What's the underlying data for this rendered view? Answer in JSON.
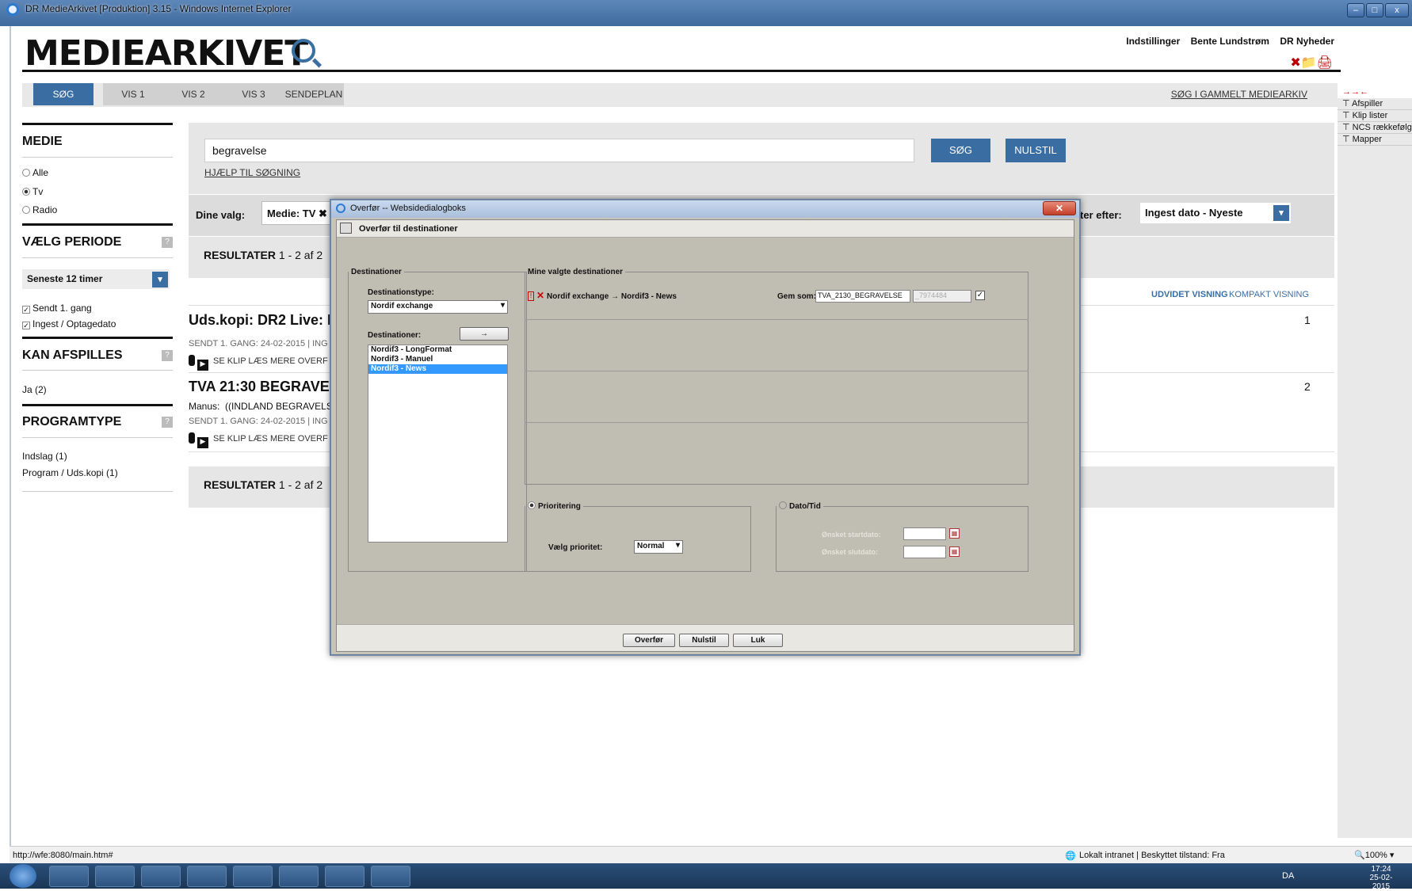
{
  "window": {
    "title": "DR MedieArkivet [Produktion] 3.15 - Windows Internet Explorer",
    "minimize": "–",
    "maximize": "□",
    "close": "x"
  },
  "header": {
    "logo": "MEDIEARKIVET",
    "settings": "Indstillinger",
    "user": "Bente Lundstrøm",
    "department": "DR Nyheder",
    "toolicons": "✖📁🖨"
  },
  "nav": {
    "tabs": [
      "SØG",
      "VIS 1",
      "VIS 2",
      "VIS 3",
      "SENDEPLAN"
    ],
    "old_archive_link": "SØG I GAMMELT MEDIEARKIV"
  },
  "right_sidebar": {
    "arrows": "→→←",
    "items": [
      "Afspiller",
      "Klip lister",
      "NCS rækkefølge",
      "Mapper"
    ]
  },
  "facets": {
    "medie": {
      "title": "MEDIE",
      "options": [
        "Alle",
        "Tv",
        "Radio"
      ],
      "selected": "Tv"
    },
    "periode": {
      "title": "VÆLG PERIODE",
      "help": "?",
      "select": "Seneste 12 timer",
      "checks": [
        "Sendt 1. gang",
        "Ingest / Optagedato"
      ]
    },
    "afspilles": {
      "title": "KAN AFSPILLES",
      "help": "?",
      "items": [
        "Ja (2)"
      ]
    },
    "programtype": {
      "title": "PROGRAMTYPE",
      "help": "?",
      "items": [
        "Indslag (1)",
        "Program / Uds.kopi (1)"
      ]
    }
  },
  "search": {
    "query": "begravelse",
    "search_button": "SØG",
    "reset_button": "NULSTIL",
    "help_link": "HJÆLP TIL SØGNING"
  },
  "filters": {
    "label": "Dine valg:",
    "chip": "Medie: TV",
    "sort_label": "ter efter:",
    "sort_value": "Ingest dato - Nyeste"
  },
  "results": {
    "header": "RESULTATER",
    "count": "1 - 2 af 2",
    "view_extended": "UDVIDET VISNING",
    "view_compact": "KOMPAKT VISNING",
    "items": [
      {
        "title": "Uds.kopi: DR2 Live: I",
        "meta": "SENDT 1. GANG: 24-02-2015  |  ING",
        "actions": "SE KLIP   LÆS MERE   OVERF",
        "number": "1",
        "manus": ""
      },
      {
        "title": "TVA 21:30 BEGRAVE",
        "manus_label": "Manus:",
        "manus": "((INDLAND BEGRAVELS",
        "meta": "SENDT 1. GANG: 24-02-2015  |  ING",
        "actions": "SE KLIP   LÆS MERE   OVERF",
        "number": "2"
      }
    ]
  },
  "dialog": {
    "title": "Overfør -- Websidedialogboks",
    "header": "Overfør til destinationer",
    "destinations_legend": "Destinationer",
    "dest_type_label": "Destinationstype:",
    "dest_type_value": "Nordif exchange",
    "dest_label": "Destinationer:",
    "add_arrow": "→",
    "dest_list": [
      "Nordif3 - LongFormat",
      "Nordif3 - Manuel",
      "Nordif3 - News"
    ],
    "dest_selected": "Nordif3 - News",
    "my_dest_legend": "Mine valgte destinationer",
    "my_dest_item": "Nordif exchange → Nordif3 - News",
    "save_as_label": "Gem som:",
    "save_as_value": "TVA_2130_BEGRAVELSE",
    "save_as_suffix": "_7974484",
    "priority_legend": "Prioritering",
    "priority_label": "Vælg prioritet:",
    "priority_value": "Normal",
    "datetime_legend": "Dato/Tid",
    "start_label": "Ønsket startdato:",
    "end_label": "Ønsket slutdato:",
    "buttons": {
      "transfer": "Overfør",
      "reset": "Nulstil",
      "close": "Luk"
    }
  },
  "statusbar": {
    "url": "http://wfe:8080/main.htm#",
    "zone": "Lokalt intranet | Beskyttet tilstand: Fra",
    "zoom": "100%"
  },
  "taskbar": {
    "lang": "DA",
    "time": "17:24",
    "date": "25-02-2015"
  }
}
